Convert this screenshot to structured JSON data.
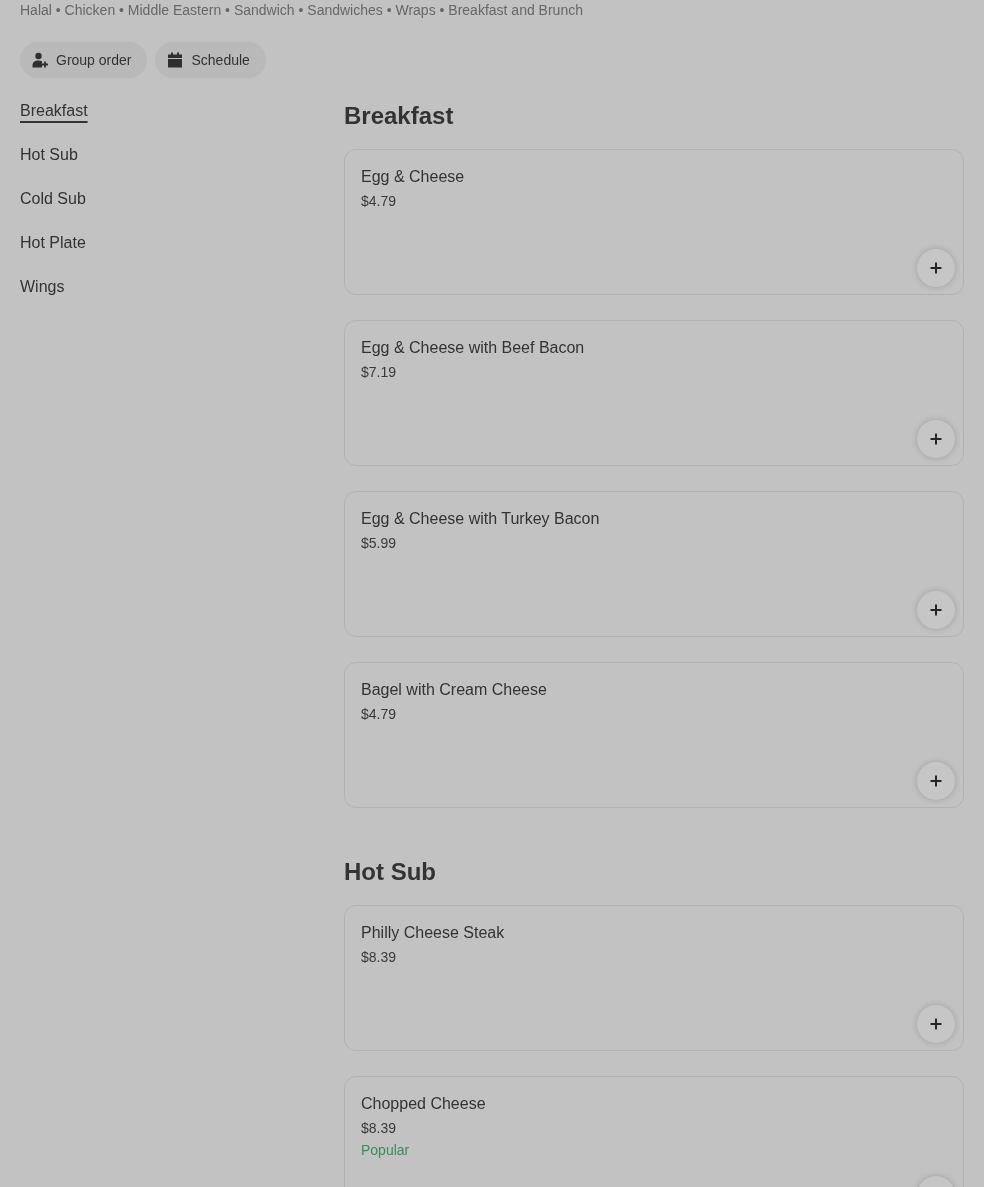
{
  "tags_line": "Halal • Chicken • Middle Eastern • Sandwich • Sandwiches • Wraps • Breakfast and Brunch",
  "actions": [
    {
      "kind": "group",
      "label": "Group order"
    },
    {
      "kind": "schedule",
      "label": "Schedule"
    }
  ],
  "sidebar": {
    "items": [
      {
        "label": "Breakfast",
        "selected": true
      },
      {
        "label": "Hot Sub",
        "selected": false
      },
      {
        "label": "Cold Sub",
        "selected": false
      },
      {
        "label": "Hot Plate",
        "selected": false
      },
      {
        "label": "Wings",
        "selected": false
      }
    ]
  },
  "sections": [
    {
      "title": "Breakfast",
      "items": [
        {
          "name": "Egg & Cheese",
          "price": "$4.79"
        },
        {
          "name": "Egg & Cheese with Beef Bacon",
          "price": "$7.19"
        },
        {
          "name": "Egg & Cheese with Turkey Bacon",
          "price": "$5.99"
        },
        {
          "name": "Bagel with Cream Cheese",
          "price": "$4.79"
        }
      ]
    },
    {
      "title": "Hot Sub",
      "items": [
        {
          "name": "Philly Cheese Steak",
          "price": "$8.39"
        },
        {
          "name": "Chopped Cheese",
          "price": "$8.39",
          "badge": "Popular"
        }
      ]
    }
  ]
}
